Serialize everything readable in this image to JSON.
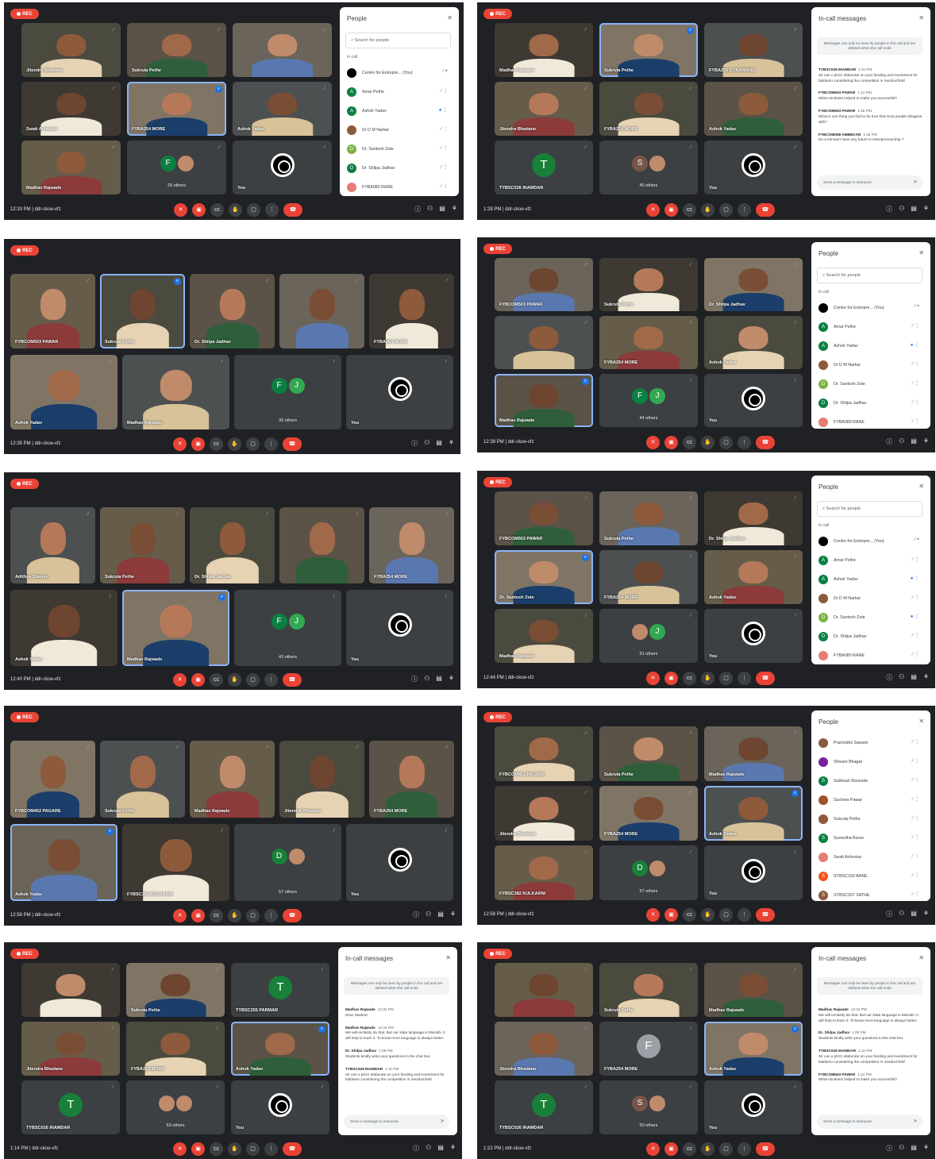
{
  "rec_label": "REC",
  "meeting_code": "ddr-ckoe-vfz",
  "labels": {
    "you": "You",
    "search": "Search for people",
    "in_call": "In call",
    "send": "Send a message to everyone",
    "notice": "Messages can only be seen by people in the call and are deleted when the call ends"
  },
  "screens": [
    {
      "time": "12:33 PM",
      "participants_badge": "",
      "panel": {
        "type": "people",
        "title": "People",
        "rows": [
          {
            "name": "Centre for Entrepre... (You)",
            "initial": "",
            "color": "#000000",
            "speaking": false
          },
          {
            "name": "Amar Pethe",
            "initial": "A",
            "color": "#0b8043",
            "speaking": false
          },
          {
            "name": "Ashok Yadav",
            "initial": "A",
            "color": "#0b8043",
            "speaking": true
          },
          {
            "name": "Dr D M Narkar",
            "initial": "",
            "color": "#8d5a3c",
            "speaking": false
          },
          {
            "name": "Dr. Santosh Zote",
            "initial": "D",
            "color": "#7cb342",
            "speaking": false
          },
          {
            "name": "Dr. Shilpa Jadhav",
            "initial": "D",
            "color": "#0b8043",
            "speaking": false
          },
          {
            "name": "FYBA080 RANE",
            "initial": "",
            "color": "#e67c73",
            "speaking": false
          }
        ]
      },
      "tiles": [
        {
          "name": "Jitendra Bhadane"
        },
        {
          "name": "Sukruta Pethe"
        },
        {
          "name": ""
        },
        {
          "name": "Swati Achrekar"
        },
        {
          "name": "FYBA254 MORE"
        },
        {
          "name": "Ashok Yadav"
        },
        {
          "name": "Madhav Rajwade"
        },
        {
          "name": "25 others",
          "initials": [
            "F",
            ""
          ]
        },
        {
          "name": "You"
        }
      ]
    },
    {
      "time": "1:28 PM",
      "participants_badge": "",
      "panel": {
        "type": "messages",
        "title": "In-call messages",
        "messages": [
          {
            "sender": "TYBSC026 INAMDAR",
            "time": "1:11 PM",
            "text": "Sir can u plzzz elaborate on your funding and investment for biddamo considering the competition in medical field"
          },
          {
            "sender": "FYBCOM503 PAWAR",
            "time": "1:21 PM",
            "text": "What mindsets helped to make you successful?"
          },
          {
            "sender": "FYBCOM503 PAWAR",
            "time": "1:26 PM",
            "text": "What is one thing you find to be true that most people disagree with?"
          },
          {
            "sender": "FYBCOM058 AMBEKAR",
            "time": "1:28 PM",
            "text": "Do a introvert have any future in entrepreneurship ?"
          }
        ]
      },
      "tiles": [
        {
          "name": "Madhav Rajwade"
        },
        {
          "name": "Sukruta Pethe"
        },
        {
          "name": "FYBA255 SONAWANE"
        },
        {
          "name": "Jitendra Bhadane"
        },
        {
          "name": "FYBA254 MORE"
        },
        {
          "name": "Ashok Yadav"
        },
        {
          "name": "TYBSC026 INAMDAR",
          "initial": "T"
        },
        {
          "name": "45 others",
          "initials": [
            "S",
            ""
          ]
        },
        {
          "name": "You"
        }
      ]
    },
    {
      "time": "12:35 PM",
      "participants_badge": "",
      "tiles": [
        {
          "name": "FYBCOM503 PAWAR"
        },
        {
          "name": "Sukruta Pethe"
        },
        {
          "name": "Dr. Shilpa Jadhav"
        },
        {
          "name": ""
        },
        {
          "name": "FYBA254 MORE"
        },
        {
          "name": "Ashok Yadav"
        },
        {
          "name": "Madhav Rajwade"
        },
        {
          "name": "35 others",
          "initials": [
            "F",
            "J"
          ]
        },
        {
          "name": "You"
        }
      ]
    },
    {
      "time": "12:39 PM",
      "participants_badge": "",
      "panel": {
        "type": "people",
        "title": "People",
        "rows": [
          {
            "name": "Centre for Entrepre... (You)",
            "initial": "",
            "color": "#000000",
            "speaking": false
          },
          {
            "name": "Amar Pethe",
            "initial": "A",
            "color": "#0b8043",
            "speaking": false
          },
          {
            "name": "Ashok Yadav",
            "initial": "A",
            "color": "#0b8043",
            "speaking": true
          },
          {
            "name": "Dr D M Narkar",
            "initial": "",
            "color": "#8d5a3c",
            "speaking": false
          },
          {
            "name": "Dr. Santosh Zote",
            "initial": "D",
            "color": "#7cb342",
            "speaking": false
          },
          {
            "name": "Dr. Shilpa Jadhav",
            "initial": "D",
            "color": "#0b8043",
            "speaking": false
          },
          {
            "name": "FYBA080 RANE",
            "initial": "",
            "color": "#e67c73",
            "speaking": false
          }
        ]
      },
      "tiles": [
        {
          "name": "FYBCOM503 PAWAR"
        },
        {
          "name": "Sukruta Pethe"
        },
        {
          "name": "Dr. Shilpa Jadhav"
        },
        {
          "name": ""
        },
        {
          "name": "FYBA254 MORE"
        },
        {
          "name": "Ashok Yadav"
        },
        {
          "name": "Madhav Rajwade"
        },
        {
          "name": "44 others",
          "initials": [
            "F",
            "J"
          ]
        },
        {
          "name": "You"
        }
      ]
    },
    {
      "time": "12:40 PM",
      "participants_badge": "",
      "tiles": [
        {
          "name": "Adithya Shenoy"
        },
        {
          "name": "Sukruta Pethe"
        },
        {
          "name": "Dr. Shilpa Jadhav"
        },
        {
          "name": ""
        },
        {
          "name": "FYBA254 MORE"
        },
        {
          "name": "Ashok Yadav"
        },
        {
          "name": "Madhav Rajwade"
        },
        {
          "name": "43 others",
          "initials": [
            "F",
            "J"
          ]
        },
        {
          "name": "You"
        }
      ]
    },
    {
      "time": "12:44 PM",
      "participants_badge": "",
      "panel": {
        "type": "people",
        "title": "People",
        "rows": [
          {
            "name": "Centre for Entrepre... (You)",
            "initial": "",
            "color": "#000000",
            "speaking": false
          },
          {
            "name": "Amar Pethe",
            "initial": "A",
            "color": "#0b8043",
            "speaking": false
          },
          {
            "name": "Ashok Yadav",
            "initial": "A",
            "color": "#0b8043",
            "speaking": true
          },
          {
            "name": "Dr D M Narkar",
            "initial": "",
            "color": "#8d5a3c",
            "speaking": false
          },
          {
            "name": "Dr. Santosh Zote",
            "initial": "D",
            "color": "#7cb342",
            "speaking": true
          },
          {
            "name": "Dr. Shilpa Jadhav",
            "initial": "D",
            "color": "#0b8043",
            "speaking": false
          },
          {
            "name": "FYBA080 RANE",
            "initial": "",
            "color": "#e67c73",
            "speaking": false
          }
        ]
      },
      "tiles": [
        {
          "name": "FYBCOM503 PAWAR"
        },
        {
          "name": "Sukruta Pethe"
        },
        {
          "name": "Dr. Shilpa Jadhav"
        },
        {
          "name": "Dr. Santosh Zote"
        },
        {
          "name": "FYBA254 MORE"
        },
        {
          "name": "Ashok Yadav"
        },
        {
          "name": "Madhav Rajwade"
        },
        {
          "name": "51 others",
          "initials": [
            "",
            "J"
          ]
        },
        {
          "name": "You"
        }
      ]
    },
    {
      "time": "12:58 PM",
      "participants_badge": "",
      "tiles": [
        {
          "name": "FYBCOM452 PAGARE"
        },
        {
          "name": "Sukruta Pethe"
        },
        {
          "name": "Madhav Rajwade"
        },
        {
          "name": "Jitendra Bhadane"
        },
        {
          "name": "FYBA254 MORE"
        },
        {
          "name": "Ashok Yadav"
        },
        {
          "name": "FYBSC382 KULKARNI"
        },
        {
          "name": "57 others",
          "initials": [
            "D",
            ""
          ]
        },
        {
          "name": "You"
        }
      ]
    },
    {
      "time": "12:58 PM",
      "participants_badge": "",
      "panel": {
        "type": "people_list",
        "title": "People",
        "rows": [
          {
            "name": "Pramodini Sawant",
            "initial": "",
            "color": "#8d5a3c",
            "speaking": false
          },
          {
            "name": "Shivam Bhagat",
            "initial": "",
            "color": "#7b1fa2",
            "speaking": false
          },
          {
            "name": "Subhash Bansode",
            "initial": "S",
            "color": "#0b8043",
            "speaking": false
          },
          {
            "name": "Sucheta Pawar",
            "initial": "",
            "color": "#a0522d",
            "speaking": false
          },
          {
            "name": "Sukruta Pethe",
            "initial": "",
            "color": "#8d5a3c",
            "speaking": false
          },
          {
            "name": "Sumedha Barve",
            "initial": "S",
            "color": "#0b8043",
            "speaking": false
          },
          {
            "name": "Swati Achrekar",
            "initial": "",
            "color": "#e67c73",
            "speaking": false
          },
          {
            "name": "SYBSC193 BANE",
            "initial": "S",
            "color": "#f4511e",
            "speaking": false
          },
          {
            "name": "SYBSC207 SATHE",
            "initial": "S",
            "color": "#8d5a3c",
            "speaking": false
          }
        ]
      },
      "tiles": [
        {
          "name": "FYBCOM452 PAGARE"
        },
        {
          "name": "Sukruta Pethe"
        },
        {
          "name": "Madhav Rajwade"
        },
        {
          "name": "Jitendra Bhadane"
        },
        {
          "name": "FYBA254 MORE"
        },
        {
          "name": "Ashok Yadav"
        },
        {
          "name": "FYBSC382 KULKARNI"
        },
        {
          "name": "57 others",
          "initials": [
            "D",
            ""
          ]
        },
        {
          "name": "You"
        }
      ]
    },
    {
      "time": "1:14 PM",
      "participants_badge": "",
      "panel": {
        "type": "messages",
        "title": "In-call messages",
        "messages": [
          {
            "sender": "Madhav Rajwade",
            "time": "12:32 PM",
            "text": "Dear Student,"
          },
          {
            "sender": "Madhav Rajwade",
            "time": "12:34 PM",
            "text": "We will certainly do that. But our state language is Marathi. It will help to learn it. To know more language is always better."
          },
          {
            "sender": "Dr. Shilpa Jadhav",
            "time": "1:09 PM",
            "text": "Students kindly write your questions in the chat box"
          },
          {
            "sender": "TYBSC026 INAMDAR",
            "time": "1:11 PM",
            "text": "Sir can u plzzz elaborate on your funding and investment for biddamo considering the competition in medical field"
          }
        ]
      },
      "tiles": [
        {
          "name": ""
        },
        {
          "name": "Sukruta Pethe"
        },
        {
          "name": "TYBSC255 PARMAR",
          "initial": "T"
        },
        {
          "name": "Jitendra Bhadane"
        },
        {
          "name": "FYBA254 MORE"
        },
        {
          "name": "Ashok Yadav"
        },
        {
          "name": "TYBSC026 INAMDAR",
          "initial": "T"
        },
        {
          "name": "53 others",
          "initials": [
            "",
            ""
          ]
        },
        {
          "name": "You"
        }
      ]
    },
    {
      "time": "1:22 PM",
      "participants_badge": "",
      "panel": {
        "type": "messages",
        "title": "In-call messages",
        "messages": [
          {
            "sender": "Madhav Rajwade",
            "time": "12:34 PM",
            "text": "We will certainly do that. But our state language is Marathi. It will help to learn it. To know more language is always better."
          },
          {
            "sender": "Dr. Shilpa Jadhav",
            "time": "1:09 PM",
            "text": "Students kindly write your questions in the chat box"
          },
          {
            "sender": "TYBSC026 INAMDAR",
            "time": "1:11 PM",
            "text": "Sir can u plzzz elaborate on your funding and investment for biddamo considering the competition in medical field"
          },
          {
            "sender": "FYBCOM503 PAWAR",
            "time": "1:21 PM",
            "text": "What mindsets helped to make you successful?"
          }
        ]
      },
      "tiles": [
        {
          "name": ""
        },
        {
          "name": "Sukruta Pethe"
        },
        {
          "name": "Madhav Rajwade"
        },
        {
          "name": "Jitendra Bhadane"
        },
        {
          "name": "FYBA254 MORE",
          "initial": "F"
        },
        {
          "name": "Ashok Yadav"
        },
        {
          "name": "TYBSC026 INAMDAR",
          "initial": "T"
        },
        {
          "name": "50 others",
          "initials": [
            "S",
            ""
          ]
        },
        {
          "name": "You"
        }
      ]
    }
  ]
}
